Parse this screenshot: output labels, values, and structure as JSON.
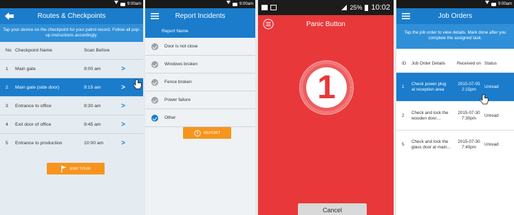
{
  "colors": {
    "primary": "#1a7ccb",
    "accent": "#f7941d",
    "panic": "#e8383a"
  },
  "routes": {
    "status_time": "9:00am",
    "title": "Routes & Checkpoints",
    "hint": "Tap your device on the checkpoint for your patrol record. Follow all pop-up instructions accordingly.",
    "columns": {
      "no": "No",
      "name": "Checkpoint Name",
      "scan": "Scan Before"
    },
    "rows": [
      {
        "no": "1",
        "name": "Main gate",
        "time": "9:00 am"
      },
      {
        "no": "2",
        "name": "Main gate (side door)",
        "time": "9:15 am"
      },
      {
        "no": "3",
        "name": "Entrance to office",
        "time": "9:30 am"
      },
      {
        "no": "4",
        "name": "Exit door of office",
        "time": "9:45 am"
      },
      {
        "no": "5",
        "name": "Entrance to production",
        "time": "10:00 am"
      }
    ],
    "arrow": ">",
    "end_tour": "END TOUR"
  },
  "incidents": {
    "status_time": "9:00am",
    "title": "Report Incidents",
    "header": "Report Name",
    "items": [
      {
        "label": "Door is not close",
        "checked": false
      },
      {
        "label": "Windows broken",
        "checked": false
      },
      {
        "label": "Fence broken",
        "checked": false
      },
      {
        "label": "Power failure",
        "checked": false
      },
      {
        "label": "Other",
        "checked": true
      }
    ],
    "report_button": "REPORT"
  },
  "panic": {
    "status_battery": "25%",
    "status_time": "10:02",
    "title": "Panic Button",
    "countdown": "1",
    "cancel": "Cancel"
  },
  "jobs": {
    "status_time": "9:00am",
    "title": "Job Orders",
    "hint": "Tap the job order to view details. Mark done after you complete the assigned task.",
    "columns": {
      "id": "ID",
      "details": "Job Order Details",
      "received": "Received on",
      "status": "Status"
    },
    "rows": [
      {
        "id": "1",
        "details": "Check power plug at reception area",
        "date": "2015-07-05",
        "time": "2:15pm",
        "status": "Unread"
      },
      {
        "id": "2",
        "details": "Check and lock the wooden door....",
        "date": "2015-07-30",
        "time": "7:30pm",
        "status": "Unread"
      },
      {
        "id": "5",
        "details": "Check and lock the glass door at main...",
        "date": "2015-07-30",
        "time": "7:40pm",
        "status": "Unread"
      }
    ]
  }
}
